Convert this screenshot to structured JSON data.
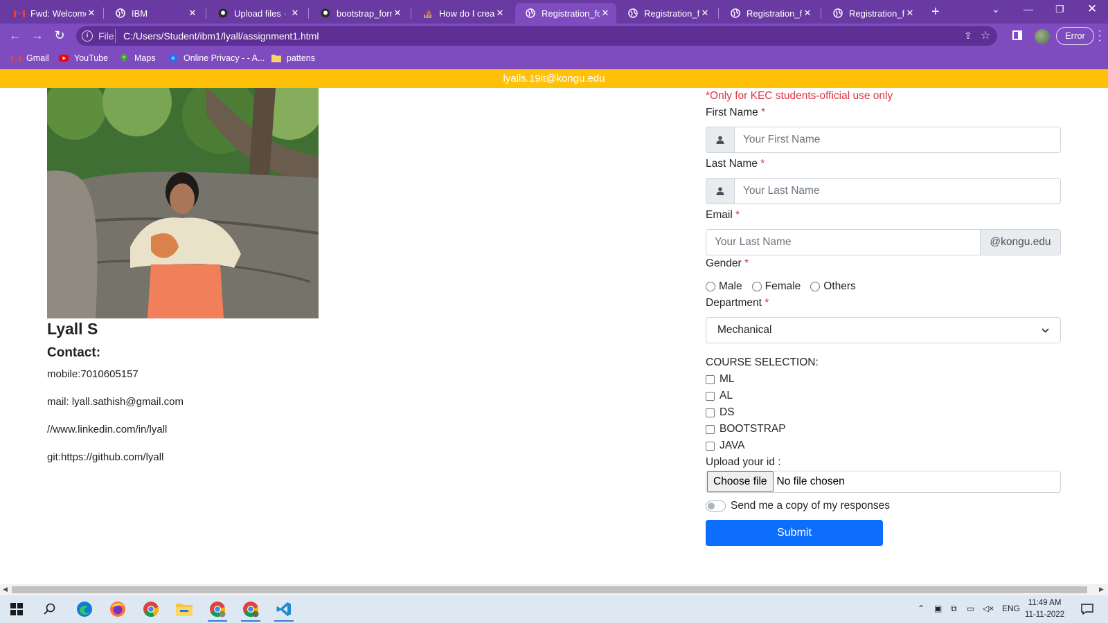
{
  "browser": {
    "tabs": [
      {
        "title": "Fwd: Welcome",
        "icon": "gmail-icon"
      },
      {
        "title": "IBM",
        "icon": "globe-icon"
      },
      {
        "title": "Upload files · IB",
        "icon": "github-icon"
      },
      {
        "title": "bootstrap_form",
        "icon": "github-icon"
      },
      {
        "title": "How do I create",
        "icon": "stackoverflow-icon"
      },
      {
        "title": "Registration_for",
        "icon": "globe-icon",
        "active": true
      },
      {
        "title": "Registration_for",
        "icon": "globe-icon"
      },
      {
        "title": "Registration_for",
        "icon": "globe-icon"
      },
      {
        "title": "Registration_for",
        "icon": "globe-icon"
      }
    ],
    "address": {
      "protocol_label": "File",
      "url": "C:/Users/Student/ibm1/lyall/assignment1.html"
    },
    "profile_status": "Error",
    "bookmarks": [
      {
        "label": "Gmail",
        "icon": "gmail-icon"
      },
      {
        "label": "YouTube",
        "icon": "youtube-icon"
      },
      {
        "label": "Maps",
        "icon": "maps-icon"
      },
      {
        "label": "Online Privacy - - A...",
        "icon": "privacy-icon"
      },
      {
        "label": "pattens",
        "icon": "folder-icon"
      }
    ]
  },
  "page": {
    "banner_email": "lyalls.19it@kongu.edu",
    "profile": {
      "name": "Lyall S",
      "contact_heading": "Contact:",
      "lines": [
        "mobile:7010605157",
        "mail: lyall.sathish@gmail.com",
        "//www.linkedin.com/in/lyall",
        "git:https://github.com/lyall"
      ]
    },
    "form": {
      "note": "*Only for KEC students-official use only",
      "first_name_label": "First Name",
      "first_name_placeholder": "Your First Name",
      "last_name_label": "Last Name",
      "last_name_placeholder": "Your Last Name",
      "email_label": "Email",
      "email_placeholder": "Your Last Name",
      "email_suffix": "@kongu.edu",
      "required_mark": "*",
      "gender_label": "Gender",
      "gender_options": [
        "Male",
        "Female",
        "Others"
      ],
      "department_label": "Department",
      "department_selected": "Mechanical",
      "course_heading": "COURSE SELECTION:",
      "courses": [
        "ML",
        "AL",
        "DS",
        "BOOTSTRAP",
        "JAVA"
      ],
      "upload_label": "Upload your id :",
      "choose_file_label": "Choose file",
      "no_file_text": "No file chosen",
      "copy_toggle_label": "Send me a copy of my responses",
      "submit_label": "Submit"
    }
  },
  "taskbar": {
    "language": "ENG",
    "time": "11:49 AM",
    "date": "11-11-2022"
  },
  "colors": {
    "browser_frame": "#7f4cbf",
    "banner": "#ffc107",
    "required": "#dc3545",
    "submit": "#0d6efd"
  }
}
